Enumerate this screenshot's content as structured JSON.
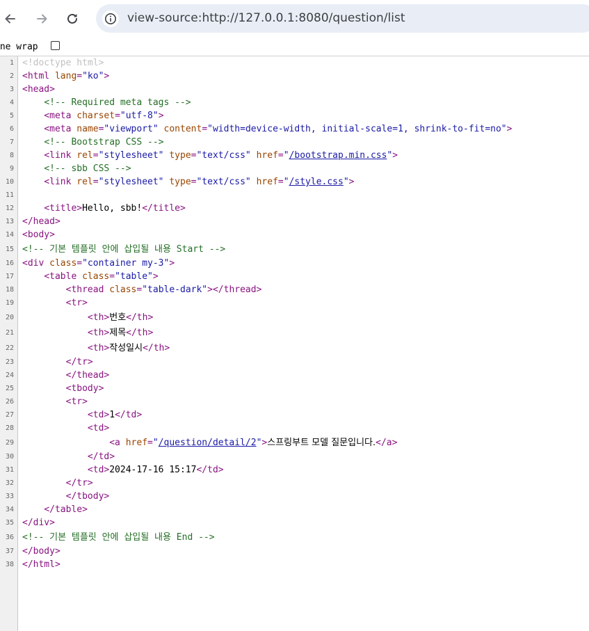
{
  "browser": {
    "url": "view-source:http://127.0.0.1:8080/question/list",
    "icons": {
      "back": "arrow-left-icon",
      "forward": "arrow-right-icon",
      "reload": "reload-icon",
      "site_info": "info-icon"
    }
  },
  "line_wrap": {
    "label": "ine wrap",
    "checked": false
  },
  "source": {
    "l1": {
      "num": "1",
      "doctype": "<!doctype html>"
    },
    "l2": {
      "num": "2",
      "open": "<html ",
      "attr": "lang",
      "eq": "=",
      "val": "\"ko\"",
      "close": ">"
    },
    "l3": {
      "num": "3",
      "tag": "<head>"
    },
    "l4": {
      "num": "4",
      "comment": "<!-- Required meta tags -->"
    },
    "l5": {
      "num": "5",
      "open": "<meta ",
      "attr": "charset",
      "eq": "=",
      "val": "\"utf-8\"",
      "close": ">"
    },
    "l6": {
      "num": "6",
      "open": "<meta ",
      "a1": "name",
      "eq1": "=",
      "v1": "\"viewport\"",
      "a2": "content",
      "eq2": "=",
      "v2": "\"width=device-width, initial-scale=1, shrink-to-fit=no\"",
      "close": ">"
    },
    "l7": {
      "num": "7",
      "comment": "<!-- Bootstrap CSS -->"
    },
    "l8": {
      "num": "8",
      "open": "<link ",
      "a1": "rel",
      "eq1": "=",
      "v1": "\"stylesheet\"",
      "a2": "type",
      "eq2": "=",
      "v2": "\"text/css\"",
      "a3": "href",
      "eq3": "=",
      "q1": "\"",
      "link": "/bootstrap.min.css",
      "q2": "\"",
      "close": ">"
    },
    "l9": {
      "num": "9",
      "comment": "<!-- sbb CSS -->"
    },
    "l10": {
      "num": "10",
      "open": "<link ",
      "a1": "rel",
      "eq1": "=",
      "v1": "\"stylesheet\"",
      "a2": "type",
      "eq2": "=",
      "v2": "\"text/css\"",
      "a3": "href",
      "eq3": "=",
      "q1": "\"",
      "link": "/style.css",
      "q2": "\"",
      "close": ">"
    },
    "l11": {
      "num": "11"
    },
    "l12": {
      "num": "12",
      "open": "<title>",
      "text": "Hello, sbb!",
      "close": "</title>"
    },
    "l13": {
      "num": "13",
      "tag": "</head>"
    },
    "l14": {
      "num": "14",
      "tag": "<body>"
    },
    "l15": {
      "num": "15",
      "comment": "<!-- 기본 템플릿 안에 삽입될 내용 Start -->"
    },
    "l16": {
      "num": "16",
      "open": "<div ",
      "attr": "class",
      "eq": "=",
      "val": "\"container my-3\"",
      "close": ">"
    },
    "l17": {
      "num": "17",
      "open": "<table ",
      "attr": "class",
      "eq": "=",
      "val": "\"table\"",
      "close": ">"
    },
    "l18": {
      "num": "18",
      "open": "<thread ",
      "attr": "class",
      "eq": "=",
      "val": "\"table-dark\"",
      "close": "></thread>"
    },
    "l19": {
      "num": "19",
      "tag": "<tr>"
    },
    "l20": {
      "num": "20",
      "open": "<th>",
      "text": "번호",
      "close": "</th>"
    },
    "l21": {
      "num": "21",
      "open": "<th>",
      "text": "제목",
      "close": "</th>"
    },
    "l22": {
      "num": "22",
      "open": "<th>",
      "text": "작성일시",
      "close": "</th>"
    },
    "l23": {
      "num": "23",
      "tag": "</tr>"
    },
    "l24": {
      "num": "24",
      "tag": "</thead>"
    },
    "l25": {
      "num": "25",
      "tag": "<tbody>"
    },
    "l26": {
      "num": "26",
      "tag": "<tr>"
    },
    "l27": {
      "num": "27",
      "open": "<td>",
      "text": "1",
      "close": "</td>"
    },
    "l28": {
      "num": "28",
      "tag": "<td>"
    },
    "l29": {
      "num": "29",
      "open": "<a ",
      "attr": "href",
      "eq": "=",
      "q1": "\"",
      "link": "/question/detail/2",
      "q2": "\"",
      "gt": ">",
      "text": "스프링부트 모델 질문입니다.",
      "close": "</a>"
    },
    "l30": {
      "num": "30",
      "tag": "</td>"
    },
    "l31": {
      "num": "31",
      "open": "<td>",
      "text": "2024-17-16 15:17",
      "close": "</td>"
    },
    "l32": {
      "num": "32",
      "tag": "</tr>"
    },
    "l33": {
      "num": "33",
      "tag": "</tbody>"
    },
    "l34": {
      "num": "34",
      "tag": "</table>"
    },
    "l35": {
      "num": "35",
      "tag": "</div>"
    },
    "l36": {
      "num": "36",
      "comment": "<!-- 기본 템플릿 안에 삽입될 내용 End -->"
    },
    "l37": {
      "num": "37",
      "tag": "</body>"
    },
    "l38": {
      "num": "38",
      "tag": "</html>"
    }
  },
  "colors": {
    "tag": "#881280",
    "attr_name": "#994500",
    "attr_value": "#1a1aa6",
    "comment": "#236e25",
    "doctype": "#c0c0c0",
    "gutter_bg": "#f0f0f0",
    "omnibox_bg": "#e9eef6"
  }
}
